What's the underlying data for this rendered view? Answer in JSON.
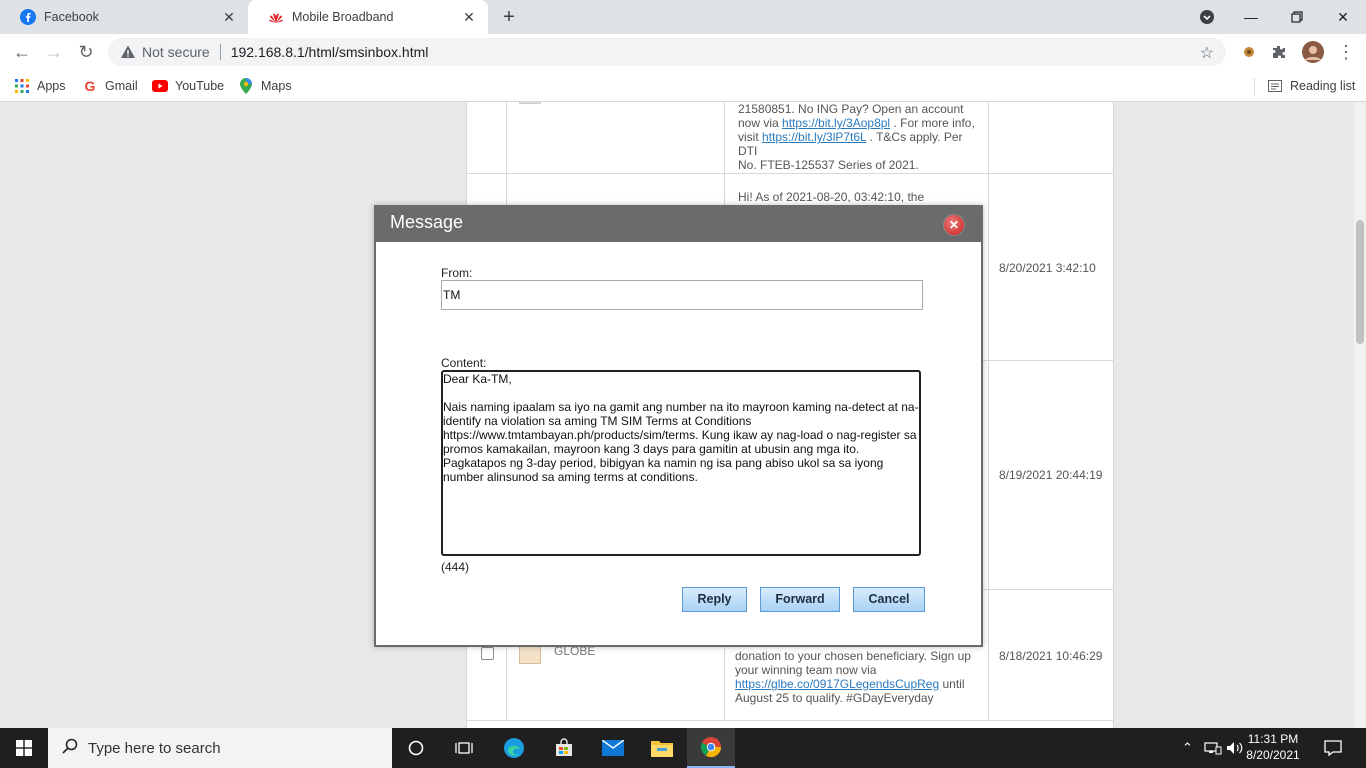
{
  "browser": {
    "tabs": [
      {
        "label": "Facebook",
        "icon": "facebook-icon"
      },
      {
        "label": "Mobile Broadband",
        "icon": "huawei-icon"
      }
    ],
    "security_label": "Not secure",
    "url": "192.168.8.1/html/smsinbox.html",
    "bookmarks": [
      {
        "label": "Apps",
        "icon": "apps-grid-icon"
      },
      {
        "label": "Gmail",
        "icon": "google-icon"
      },
      {
        "label": "YouTube",
        "icon": "youtube-icon"
      },
      {
        "label": "Maps",
        "icon": "maps-icon"
      }
    ],
    "reading_list_label": "Reading list"
  },
  "inbox": {
    "rows": [
      {
        "sender": "",
        "message_lines": [
          "21580851. No ING Pay? Open an account",
          "now via ",
          "https://bit.ly/3Aop8pl",
          " . For more info,",
          "visit ",
          "https://bit.ly/3lP7t6L",
          " . T&Cs apply. Per DTI",
          "No. FTEB-125537 Series of 2021."
        ],
        "date": ""
      },
      {
        "sender": "",
        "message_lines": [
          "Hi! As of 2021-08-20, 03:42:10, the remaining"
        ],
        "date": "8/20/2021 3:42:10"
      },
      {
        "sender": "",
        "message_lines": [],
        "date": "8/19/2021 20:44:19"
      },
      {
        "sender": "GLOBE",
        "message_lines": [
          "donation to your chosen beneficiary. Sign up",
          "your winning team now via",
          "https://glbe.co/0917GLegendsCupReg",
          "  until",
          "August 25 to qualify. #GDayEveryday"
        ],
        "date": "8/18/2021 10:46:29"
      }
    ]
  },
  "modal": {
    "title": "Message",
    "from_label": "From:",
    "from_value": "TM",
    "content_label": "Content:",
    "content_value": "Dear Ka-TM,\n\nNais naming ipaalam sa iyo na gamit ang number na ito mayroon kaming na-detect at na-identify na violation sa aming TM SIM Terms at Conditions https://www.tmtambayan.ph/products/sim/terms. Kung ikaw ay nag-load o nag-register sa promos kamakailan, mayroon kang 3 days para gamitin at ubusin ang mga ito. Pagkatapos ng 3-day period, bibigyan ka namin ng isa pang abiso ukol sa sa iyong number alinsunod sa aming terms at conditions.",
    "char_count": "(444)",
    "buttons": {
      "reply": "Reply",
      "forward": "Forward",
      "cancel": "Cancel"
    }
  },
  "taskbar": {
    "search_placeholder": "Type here to search",
    "time": "11:31 PM",
    "date": "8/20/2021"
  }
}
